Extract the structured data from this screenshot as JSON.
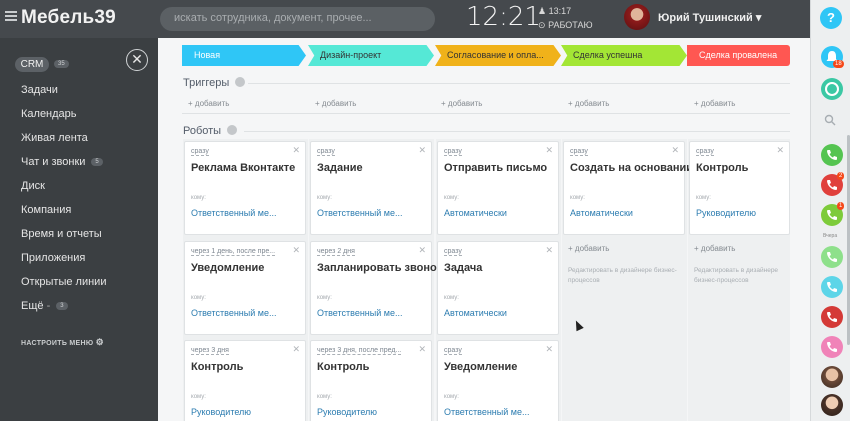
{
  "app": {
    "logo": "Мебель39"
  },
  "topbar": {
    "search_placeholder": "искать сотрудника, документ, прочее...",
    "time": "12:21",
    "work_time": "13:17",
    "work_status": "РАБОТАЮ",
    "user_name": "Юрий Тушинский"
  },
  "sidebar": {
    "crm_label": "CRM",
    "crm_count": "35",
    "items": [
      {
        "label": "Задачи"
      },
      {
        "label": "Календарь"
      },
      {
        "label": "Живая лента"
      },
      {
        "label": "Чат и звонки",
        "count": "5"
      },
      {
        "label": "Диск"
      },
      {
        "label": "Компания"
      },
      {
        "label": "Время и отчеты"
      },
      {
        "label": "Приложения"
      },
      {
        "label": "Открытые линии"
      },
      {
        "label": "Ещё",
        "count": "3"
      }
    ],
    "setup_label": "НАСТРОИТЬ МЕНЮ"
  },
  "stages": [
    {
      "label": "Новая",
      "color": "#2fc6f6",
      "text_color": "#ffffff"
    },
    {
      "label": "Дизайн-проект",
      "color": "#55e8d6",
      "text_color": "#333333"
    },
    {
      "label": "Согласование и опла...",
      "color": "#f0b21a",
      "text_color": "#333333"
    },
    {
      "label": "Сделка успешна",
      "color": "#a3e635",
      "text_color": "#333333"
    },
    {
      "label": "Сделка провалена",
      "color": "#ff5752",
      "text_color": "#ffffff"
    }
  ],
  "triggers": {
    "title": "Триггеры",
    "add_label": "+ добавить"
  },
  "robots": {
    "title": "Роботы",
    "who_label": "кому:",
    "columns": [
      [
        {
          "when": "сразу",
          "title": "Реклама Вконтакте",
          "target": "Ответственный ме..."
        },
        {
          "when": "через 1 день, после пре...",
          "title": "Уведомление",
          "target": "Ответственный ме..."
        },
        {
          "when": "через 3 дня",
          "title": "Контроль",
          "target": "Руководителю"
        }
      ],
      [
        {
          "when": "сразу",
          "title": "Задание",
          "target": "Ответственный ме..."
        },
        {
          "when": "через 2 дня",
          "title": "Запланировать звонок",
          "target": "Ответственный ме..."
        },
        {
          "when": "через 3 дня, после пред...",
          "title": "Контроль",
          "target": "Руководителю"
        }
      ],
      [
        {
          "when": "сразу",
          "title": "Отправить письмо",
          "target": "Автоматически"
        },
        {
          "when": "сразу",
          "title": "Задача",
          "target": "Автоматически"
        },
        {
          "when": "сразу",
          "title": "Уведомление",
          "target": "Ответственный ме..."
        }
      ],
      [
        {
          "when": "сразу",
          "title": "Создать на основании",
          "target": "Автоматически"
        }
      ],
      [
        {
          "when": "сразу",
          "title": "Контроль",
          "target": "Руководителю"
        }
      ]
    ],
    "add_label": "+ добавить",
    "hint": "Редактировать в дизайнере бизнес-процессов"
  },
  "right_panel": {
    "help": "?",
    "notif_count": "18",
    "badge_2": "2",
    "badge_1": "1",
    "yesterday_label": "Вчера"
  }
}
